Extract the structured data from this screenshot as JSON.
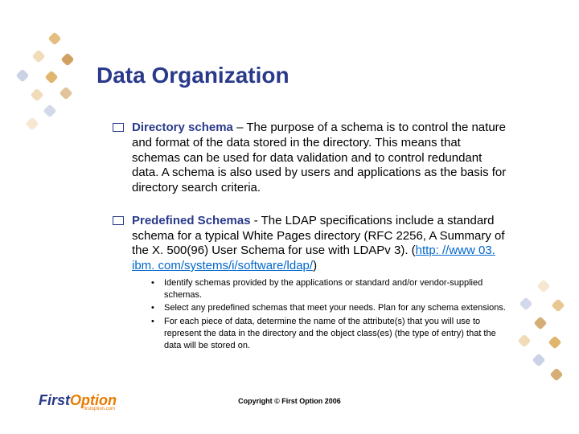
{
  "title": "Data Organization",
  "bullets": [
    {
      "heading": "Directory schema",
      "sep": " – ",
      "body": "The purpose of a schema is to control the nature and format of the data stored in the directory. This means that schemas can be used for data validation and to control redundant data. A schema is also used by users and applications as the basis for directory search criteria."
    },
    {
      "heading": "Predefined Schemas",
      "sep": " -  ",
      "body_pre": "The LDAP specifications include a standard schema for a typical White Pages directory (RFC 2256, A Summary of the X. 500(96) User Schema for use with LDAPv 3). (",
      "link": "http: //www 03. ibm. com/systems/i/software/ldap/",
      "body_post": ")"
    }
  ],
  "sub_bullets": [
    "Identify schemas provided by the applications or  standard and/or vendor-supplied schemas.",
    "Select any predefined schemas that meet your needs.  Plan for any schema extensions.",
    "For each piece of data, determine the name of the attribute(s) that you will use to represent the data in the directory and the object class(es) (the type of entry) that the data will be stored on."
  ],
  "logo": {
    "first": "First",
    "option": "Option",
    "sub": "firstoption.com"
  },
  "copyright": "Copyright © First Option 2006"
}
